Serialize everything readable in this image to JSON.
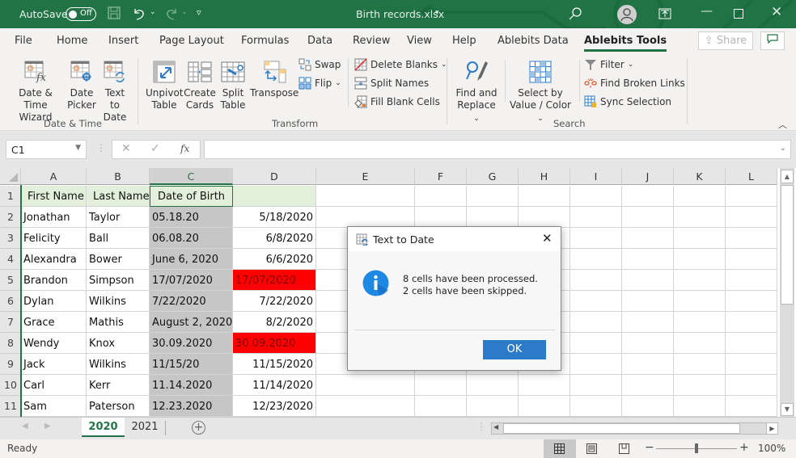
{
  "titlebar": {
    "autosave_label": "AutoSave",
    "autosave_state": "Off",
    "document_title": "Birth records.xlsx",
    "icons": [
      "save-icon",
      "undo-icon",
      "redo-icon",
      "customize-icon",
      "search-icon",
      "account-icon",
      "ribbon-display-icon",
      "minimize-icon",
      "maximize-icon",
      "close-icon"
    ]
  },
  "menu": {
    "items": [
      "File",
      "Home",
      "Insert",
      "Page Layout",
      "Formulas",
      "Data",
      "Review",
      "View",
      "Help",
      "Ablebits Data",
      "Ablebits Tools"
    ],
    "active": "Ablebits Tools",
    "share_label": "Share"
  },
  "ribbon": {
    "groups": [
      {
        "label": "Date & Time",
        "buttons": [
          {
            "line1": "Date &",
            "line2": "Time Wizard"
          },
          {
            "line1": "Date",
            "line2": "Picker"
          },
          {
            "line1": "Text to",
            "line2": "Date"
          }
        ]
      },
      {
        "label": "Transform",
        "buttons": [
          {
            "line1": "Unpivot",
            "line2": "Table"
          },
          {
            "line1": "Create",
            "line2": "Cards"
          },
          {
            "line1": "Split",
            "line2": "Table"
          },
          {
            "line1": "Transpose",
            "line2": ""
          }
        ],
        "small": [
          "Swap",
          "Flip"
        ]
      },
      {
        "label": "",
        "small": [
          "Delete Blanks",
          "Split Names",
          "Fill Blank Cells"
        ]
      },
      {
        "label": "Search",
        "buttons": [
          {
            "line1": "Find and",
            "line2": "Replace"
          },
          {
            "line1": "Select by",
            "line2": "Value / Color"
          }
        ],
        "small": [
          "Filter",
          "Find Broken Links",
          "Sync Selection"
        ]
      }
    ]
  },
  "formula_bar": {
    "name_box": "C1",
    "formula": "",
    "fx_label": "fx"
  },
  "sheet": {
    "columns": [
      "A",
      "B",
      "C",
      "D",
      "E",
      "F",
      "G",
      "H",
      "I",
      "J",
      "K",
      "L"
    ],
    "selected_column": "C",
    "rows": [
      {
        "n": "1",
        "a": "First Name",
        "b": "Last Name",
        "c": "Date of Birth",
        "d": ""
      },
      {
        "n": "2",
        "a": "Jonathan",
        "b": "Taylor",
        "c": "05.18.20",
        "d": "5/18/2020"
      },
      {
        "n": "3",
        "a": "Felicity",
        "b": "Ball",
        "c": "06.08.20",
        "d": "6/8/2020"
      },
      {
        "n": "4",
        "a": "Alexandra",
        "b": "Bower",
        "c": "June 6, 2020",
        "d": "6/6/2020"
      },
      {
        "n": "5",
        "a": "Brandon",
        "b": "Simpson",
        "c": "17/07/2020",
        "d": "17/07/2020",
        "error": true
      },
      {
        "n": "6",
        "a": "Dylan",
        "b": "Wilkins",
        "c": "7/22/2020",
        "d": "7/22/2020"
      },
      {
        "n": "7",
        "a": "Grace",
        "b": "Mathis",
        "c": "August 2, 2020",
        "d": "8/2/2020"
      },
      {
        "n": "8",
        "a": "Wendy",
        "b": "Knox",
        "c": "30.09.2020",
        "d": "30.09.2020",
        "error": true
      },
      {
        "n": "9",
        "a": "Jack",
        "b": "Wilkins",
        "c": "11/15/20",
        "d": "11/15/2020"
      },
      {
        "n": "10",
        "a": "Carl",
        "b": "Kerr",
        "c": "11.14.2020",
        "d": "11/14/2020"
      },
      {
        "n": "11",
        "a": "Sam",
        "b": "Paterson",
        "c": "12.23.2020",
        "d": "12/23/2020"
      }
    ],
    "colors": {
      "header_fill": "#e2efda",
      "source_fill": "#c6c6c6",
      "error_fill": "#ff0000",
      "accent": "#217346"
    }
  },
  "tabs": {
    "items": [
      "2020",
      "2021"
    ],
    "active": "2020"
  },
  "status": {
    "text": "Ready",
    "zoom": "100%",
    "zoom_fraction": 0.5
  },
  "dialog": {
    "title": "Text to Date",
    "line1": "8 cells have been processed.",
    "line2": "2 cells have been skipped.",
    "ok_label": "OK"
  }
}
